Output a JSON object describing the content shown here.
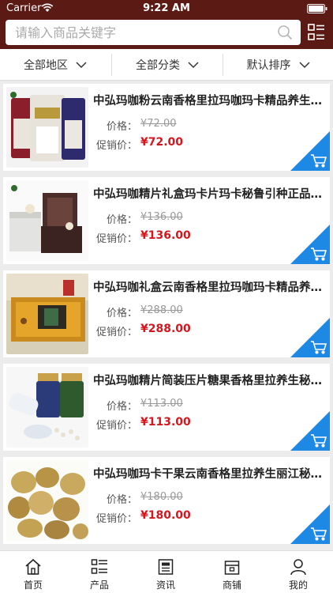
{
  "status": {
    "carrier": "Carrier",
    "time": "9:22 AM"
  },
  "search": {
    "placeholder": "请输入商品关键字"
  },
  "filters": [
    {
      "label": "全部地区"
    },
    {
      "label": "全部分类"
    },
    {
      "label": "默认排序"
    }
  ],
  "labels": {
    "price": "价格：",
    "sale": "促销价："
  },
  "products": [
    {
      "title": "中弘玛咖粉云南香格里拉玛咖玛卡精品养生...",
      "price": "¥72.00",
      "sale_price": "¥72.00",
      "image": "maca-powder-bags"
    },
    {
      "title": "中弘玛咖精片礼盒玛卡片玛卡秘鲁引种正品...",
      "price": "¥136.00",
      "sale_price": "¥136.00",
      "image": "maca-gift-box"
    },
    {
      "title": "中弘玛咖礼盒云南香格里拉玛咖玛卡精品养...",
      "price": "¥288.00",
      "sale_price": "¥288.00",
      "image": "maca-open-gift-box"
    },
    {
      "title": "中弘玛咖精片简装压片糖果香格里拉养生秘...",
      "price": "¥113.00",
      "sale_price": "¥113.00",
      "image": "maca-tablet-bottles"
    },
    {
      "title": "中弘玛咖玛卡干果云南香格里拉养生丽江秘...",
      "price": "¥180.00",
      "sale_price": "¥180.00",
      "image": "dried-maca-roots"
    }
  ],
  "tabs": [
    {
      "label": "首页",
      "icon": "home-icon"
    },
    {
      "label": "产品",
      "icon": "product-list-icon"
    },
    {
      "label": "资讯",
      "icon": "news-icon"
    },
    {
      "label": "商铺",
      "icon": "shop-icon"
    },
    {
      "label": "我的",
      "icon": "user-icon"
    }
  ],
  "colors": {
    "header": "#5c1a14",
    "accent": "#1e88e5",
    "sale": "#d8141c"
  }
}
